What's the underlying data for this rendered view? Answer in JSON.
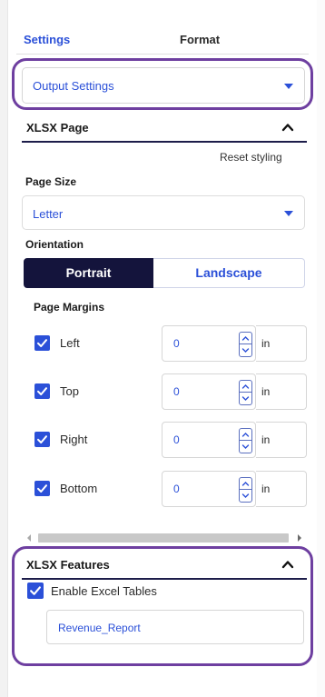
{
  "tabs": {
    "settings": "Settings",
    "format": "Format"
  },
  "output_dropdown": {
    "value": "Output Settings"
  },
  "xlsx_page": {
    "title": "XLSX Page",
    "reset_label": "Reset styling",
    "page_size_label": "Page Size",
    "page_size_value": "Letter",
    "orientation_label": "Orientation",
    "orientation_options": [
      "Portrait",
      "Landscape"
    ],
    "orientation_selected": "Portrait",
    "margins_label": "Page Margins",
    "margins": [
      {
        "label": "Left",
        "checked": true,
        "value": "0",
        "unit": "in"
      },
      {
        "label": "Top",
        "checked": true,
        "value": "0",
        "unit": "in"
      },
      {
        "label": "Right",
        "checked": true,
        "value": "0",
        "unit": "in"
      },
      {
        "label": "Bottom",
        "checked": true,
        "value": "0",
        "unit": "in"
      }
    ]
  },
  "xlsx_features": {
    "title": "XLSX Features",
    "enable_tables_label": "Enable Excel Tables",
    "enable_tables_checked": true,
    "table_name_value": "Revenue_Report"
  },
  "icons": {
    "collapse": "chevron-up-icon",
    "dropdown": "caret-down-icon",
    "checkbox": "checkmark-icon",
    "spinner_up": "spin-up-icon",
    "spinner_down": "spin-down-icon"
  },
  "colors": {
    "accent": "#2b50d8",
    "selected_segment": "#14143c",
    "highlight_outline": "#6e3fa0",
    "section_rule": "#1d1d4a"
  }
}
